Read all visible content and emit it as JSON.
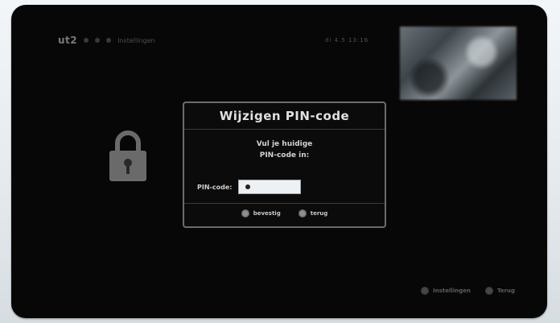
{
  "topbar": {
    "logo": "ut2",
    "breadcrumb": "Instellingen"
  },
  "clock": "di 4.5 13:16",
  "dialog": {
    "title": "Wijzigen PIN-code",
    "message_line1": "Vul je huidige",
    "message_line2": "PIN-code in:",
    "pin_label": "PIN-code:",
    "pin_value": "",
    "confirm_label": "bevestig",
    "back_label": "terug"
  },
  "footer": {
    "info_label": "Instellingen",
    "exit_label": "Terug"
  },
  "colors": {
    "screen_bg": "#070707",
    "dialog_border": "#6c6c6c",
    "text": "#e0e0e0"
  }
}
